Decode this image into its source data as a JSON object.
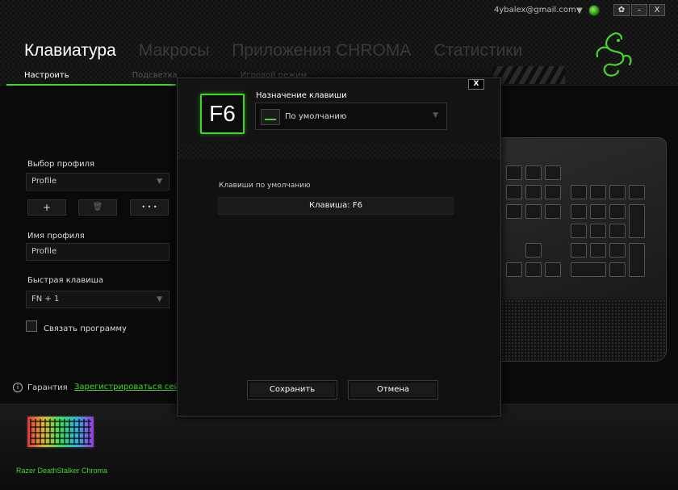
{
  "header": {
    "email": "4ybalex@gmail.com",
    "window_buttons": {
      "settings": "✿",
      "minimize": "–",
      "close": "X"
    },
    "nav": [
      "Клавиатура",
      "Макросы",
      "Приложения CHROMA",
      "Статистики"
    ],
    "subnav": [
      "Настроить",
      "Подсветка",
      "Игровой режим"
    ]
  },
  "left": {
    "profile_label": "Выбор профиля",
    "profile_value": "Profile",
    "add_btn": "+",
    "delete_btn": "🗑",
    "more_btn": "• • •",
    "profile_name_label": "Имя профиля",
    "profile_name_value": "Profile",
    "hotkey_label": "Быстрая клавиша",
    "hotkey_value": "FN + 1",
    "link_program_label": "Связать программу",
    "warranty_label": "Гарантия",
    "register_link": "Зарегистрироваться сей"
  },
  "device": {
    "name": "Razer DeathStalker Chroma"
  },
  "modal": {
    "close": "X",
    "key": "F6",
    "assign_label": "Назначение клавиши",
    "assign_value": "По умолчанию",
    "defaults_label": "Клавиши по умолчанию",
    "key_field": "Клавиша: F6",
    "save": "Сохранить",
    "cancel": "Отмена"
  },
  "colors": {
    "accent": "#44d62c"
  }
}
